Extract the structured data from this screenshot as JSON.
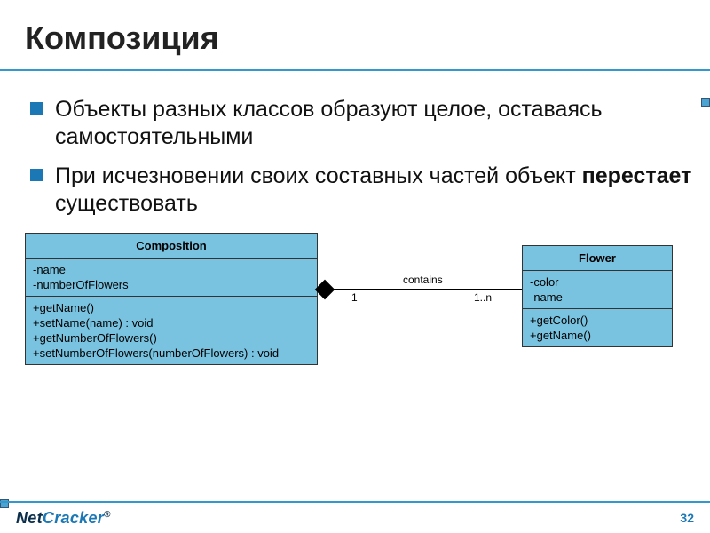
{
  "title": "Композиция",
  "bullets": [
    {
      "prefix": "Объекты разных классов образуют целое, оставаясь самостоятельными",
      "bold": "",
      "suffix": ""
    },
    {
      "prefix": "При исчезновении своих составных частей объект ",
      "bold": "перестает",
      "suffix": " существовать"
    }
  ],
  "uml": {
    "left": {
      "name": "Composition",
      "attrs": [
        "-name",
        "-numberOfFlowers"
      ],
      "ops": [
        "+getName()",
        "+setName(name) : void",
        "+getNumberOfFlowers()",
        "+setNumberOfFlowers(numberOfFlowers) : void"
      ]
    },
    "right": {
      "name": "Flower",
      "attrs": [
        "-color",
        "-name"
      ],
      "ops": [
        "+getColor()",
        "+getName()"
      ]
    },
    "relation": {
      "label": "contains",
      "leftMult": "1",
      "rightMult": "1..n"
    }
  },
  "footer": {
    "logo_a": "Net",
    "logo_b": "Cracker",
    "reg": "®",
    "page": "32"
  }
}
